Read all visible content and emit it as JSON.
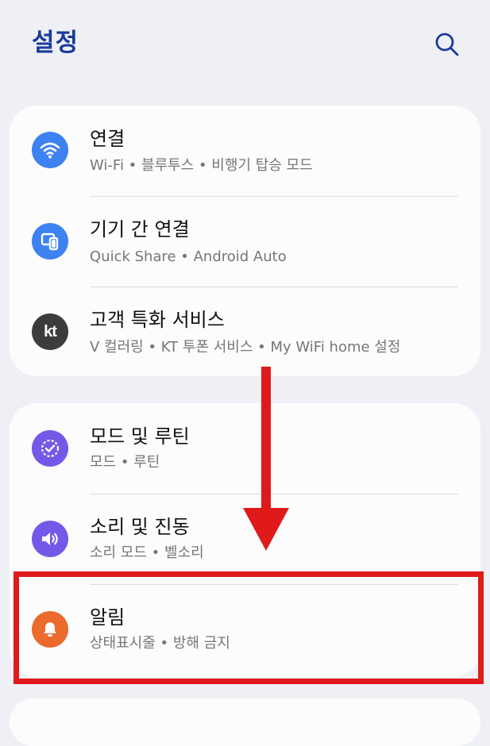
{
  "header": {
    "title": "설정",
    "search_icon": "search-icon"
  },
  "groups": [
    {
      "items": [
        {
          "title": "연결",
          "subtitle": "Wi-Fi  •  블루투스  •  비행기 탑승 모드",
          "icon": "wifi-icon",
          "color": "#3D82F0"
        },
        {
          "title": "기기 간 연결",
          "subtitle": "Quick Share  •  Android Auto",
          "icon": "devices-icon",
          "color": "#3D82F0"
        },
        {
          "title": "고객 특화 서비스",
          "subtitle": "V 컬러링  •  KT 투폰 서비스  •  My WiFi home 설정",
          "icon": "kt-logo-icon",
          "icon_text": "kt",
          "color": "#3C3C3C"
        }
      ]
    },
    {
      "items": [
        {
          "title": "모드 및 루틴",
          "subtitle": "모드  •  루틴",
          "icon": "modes-routines-icon",
          "color": "#7459E8"
        },
        {
          "title": "소리 및 진동",
          "subtitle": "소리 모드  •  벨소리",
          "icon": "speaker-icon",
          "color": "#7459E8"
        },
        {
          "title": "알림",
          "subtitle": "상태표시줄  •  방해 금지",
          "icon": "bell-icon",
          "color": "#EB6A2C"
        }
      ]
    }
  ],
  "annotation": {
    "color": "#E01A1A",
    "arrow": "down-arrow",
    "highlighted_item": "알림"
  }
}
